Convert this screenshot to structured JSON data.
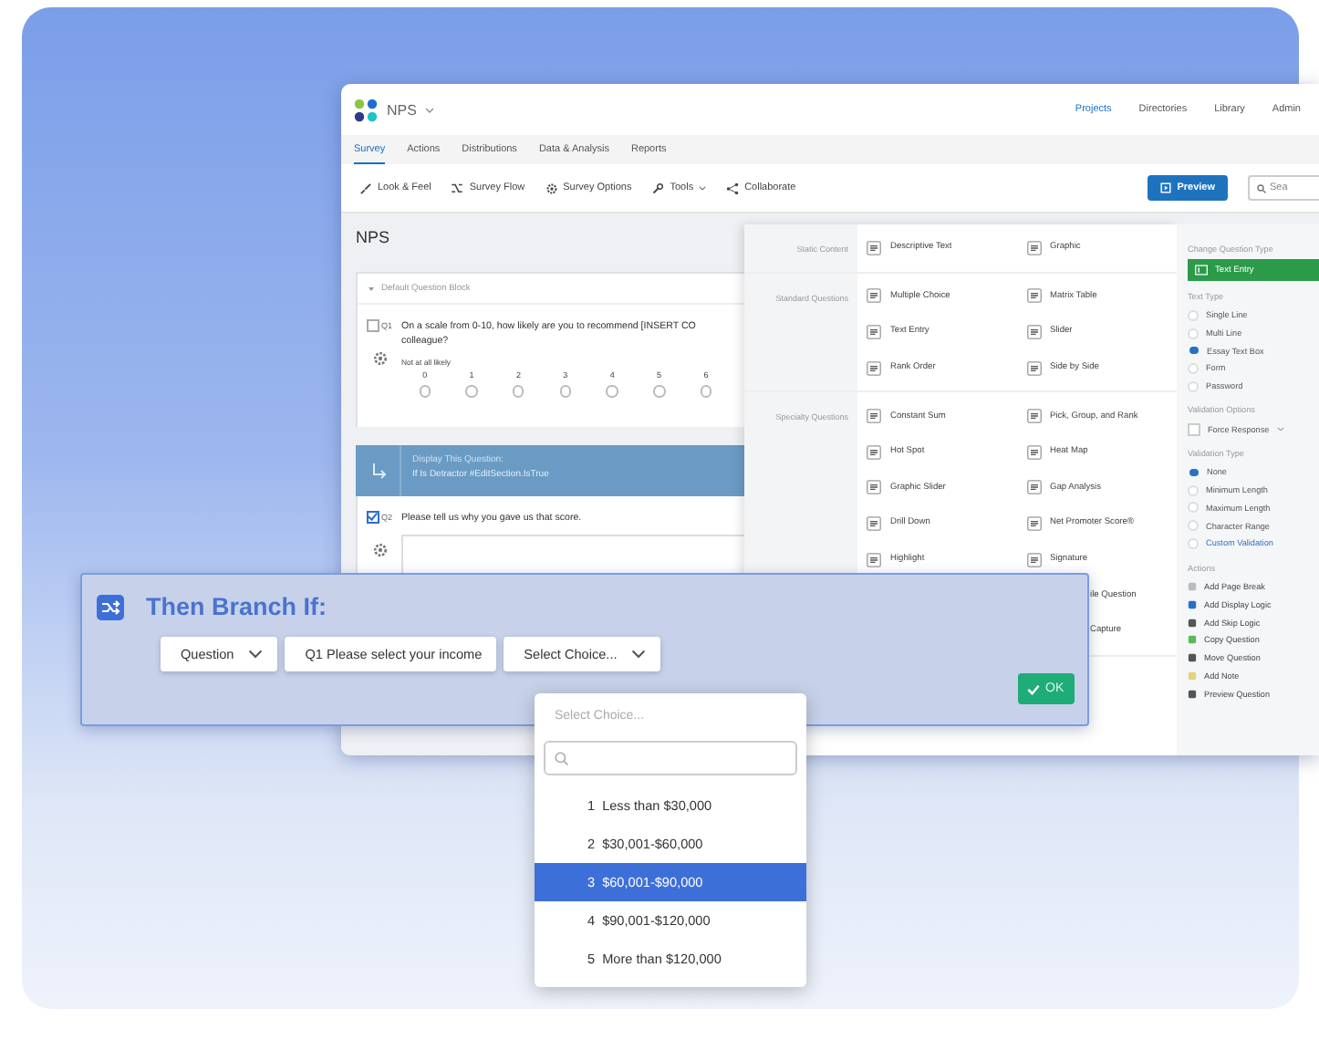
{
  "app": {
    "title": "NPS",
    "nav": [
      {
        "label": "Projects",
        "selected": true
      },
      {
        "label": "Directories",
        "selected": false
      },
      {
        "label": "Library",
        "selected": false
      },
      {
        "label": "Admin",
        "selected": false
      }
    ],
    "tabs": [
      {
        "label": "Survey",
        "selected": true
      },
      {
        "label": "Actions",
        "selected": false
      },
      {
        "label": "Distributions",
        "selected": false
      },
      {
        "label": "Data & Analysis",
        "selected": false
      },
      {
        "label": "Reports",
        "selected": false
      }
    ],
    "toolbar": [
      {
        "label": "Look & Feel",
        "dropdown": false
      },
      {
        "label": "Survey Flow",
        "dropdown": false
      },
      {
        "label": "Survey Options",
        "dropdown": false
      },
      {
        "label": "Tools",
        "dropdown": true
      },
      {
        "label": "Collaborate",
        "dropdown": false
      }
    ],
    "preview_button": "Preview",
    "search": {
      "placeholder": "Sea"
    }
  },
  "editor": {
    "title": "NPS",
    "block": "Default Question Block",
    "questions": [
      {
        "number": "Q1",
        "checked": false,
        "text_lines": [
          "On a scale from 0-10, how likely are you to recommend [INSERT CO",
          "colleague?"
        ],
        "scale_label": "Not at all likely",
        "scale": [
          {
            "label": "0",
            "selected": false
          },
          {
            "label": "1",
            "selected": false
          },
          {
            "label": "2",
            "selected": false
          },
          {
            "label": "3",
            "selected": false
          },
          {
            "label": "4",
            "selected": false
          },
          {
            "label": "5",
            "selected": false
          },
          {
            "label": "6",
            "selected": false
          }
        ]
      },
      {
        "number": "Q2",
        "checked": true,
        "display_logic": {
          "heading": "Display This Question:",
          "condition": "If Is Detractor #EditSection.IsTrue"
        },
        "text_lines": [
          "Please tell us why you gave us that score."
        ]
      }
    ]
  },
  "question_types": {
    "groups": [
      {
        "label": "Static Content",
        "items": [
          "Descriptive Text",
          "Graphic"
        ]
      },
      {
        "label": "Standard Questions",
        "items": [
          "Multiple Choice",
          "Matrix Table",
          "Text Entry",
          "Slider",
          "Rank Order",
          "Side by Side"
        ]
      },
      {
        "label": "Specialty Questions",
        "items": [
          "Constant Sum",
          "Pick, Group, and Rank",
          "Hot Spot",
          "Heat Map",
          "Graphic Slider",
          "Gap Analysis",
          "Drill Down",
          "Net Promoter Score®",
          "Highlight",
          "Signature"
        ],
        "partial_items": [
          "ile Question",
          "Capture"
        ]
      }
    ]
  },
  "properties": {
    "change_type": {
      "heading": "Change Question Type",
      "button": "Text Entry"
    },
    "text_type": {
      "heading": "Text Type",
      "options": [
        {
          "label": "Single Line",
          "selected": false
        },
        {
          "label": "Multi Line",
          "selected": false
        },
        {
          "label": "Essay Text Box",
          "selected": true
        },
        {
          "label": "Form",
          "selected": false
        },
        {
          "label": "Password",
          "selected": false
        }
      ]
    },
    "validation_options": {
      "heading": "Validation Options",
      "force_response": {
        "label": "Force Response",
        "checked": false
      }
    },
    "validation_type": {
      "heading": "Validation Type",
      "options": [
        {
          "label": "None",
          "selected": true,
          "kind": "option"
        },
        {
          "label": "Minimum Length",
          "selected": false,
          "kind": "option"
        },
        {
          "label": "Maximum Length",
          "selected": false,
          "kind": "option"
        },
        {
          "label": "Character Range",
          "selected": false,
          "kind": "option"
        },
        {
          "label": "Custom Validation",
          "selected": false,
          "kind": "link"
        }
      ]
    },
    "actions": {
      "heading": "Actions",
      "items": [
        "Add Page Break",
        "Add Display Logic",
        "Add Skip Logic",
        "Copy Question",
        "Move Question",
        "Add Note",
        "Preview Question"
      ]
    }
  },
  "branch": {
    "title": "Then Branch If:",
    "fields": [
      {
        "label": "Question",
        "dropdown": true
      },
      {
        "label": "Q1 Please select your income",
        "dropdown": false
      },
      {
        "label": "Select Choice...",
        "dropdown": true
      }
    ],
    "ok": "OK"
  },
  "choice_menu": {
    "placeholder": "Select Choice...",
    "options": [
      {
        "number": "1",
        "label": "Less than $30,000",
        "selected": false
      },
      {
        "number": "2",
        "label": "$30,001-$60,000",
        "selected": false
      },
      {
        "number": "3",
        "label": "$60,001-$90,000",
        "selected": true
      },
      {
        "number": "4",
        "label": "$90,001-$120,000",
        "selected": false
      },
      {
        "number": "5",
        "label": "More than $120,000",
        "selected": false
      }
    ]
  }
}
